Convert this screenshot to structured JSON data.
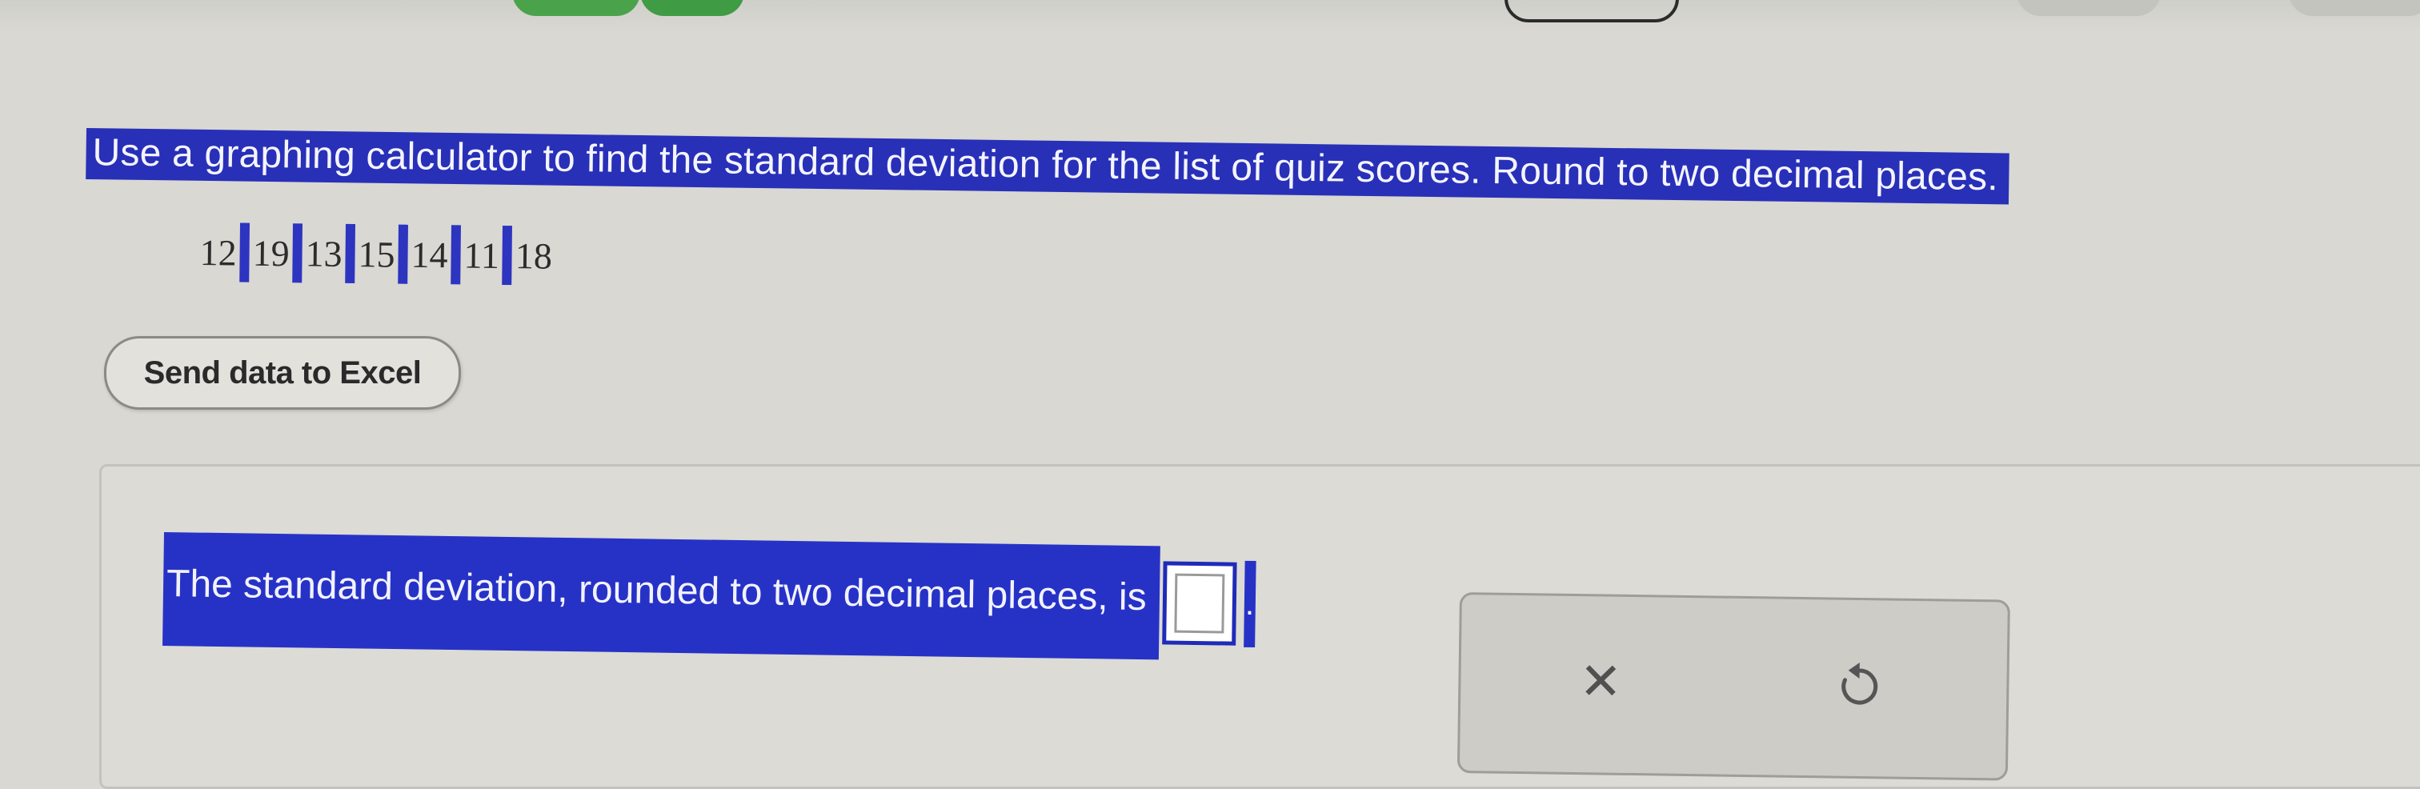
{
  "question": {
    "text": "Use a graphing calculator to find the standard deviation for the list of quiz scores. Round to two decimal places."
  },
  "quiz_scores": [
    "12",
    "19",
    "13",
    "15",
    "14",
    "11",
    "18"
  ],
  "send_button": {
    "label": "Send data to Excel"
  },
  "answer": {
    "prompt": "The standard deviation, rounded to two decimal places, is",
    "value": "",
    "suffix": "."
  },
  "tools": {
    "clear_icon": "x-icon",
    "undo_icon": "undo-icon",
    "clear_glyph": "✕"
  },
  "colors": {
    "selection_highlight": "#2830b8",
    "page_background": "#d9d8d2"
  }
}
